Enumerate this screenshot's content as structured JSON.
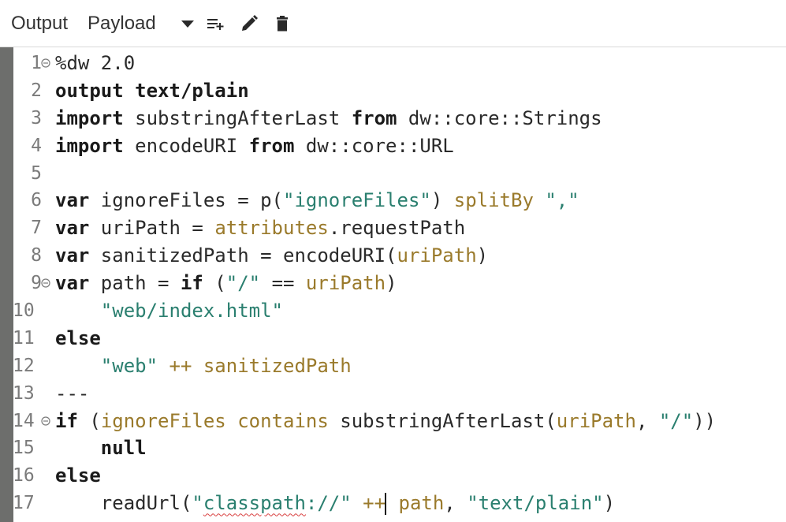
{
  "toolbar": {
    "output_label": "Output",
    "target_label": "Payload",
    "icons": [
      "chevron-down-icon",
      "add-icon",
      "edit-icon",
      "delete-icon"
    ]
  },
  "editor": {
    "lines": [
      {
        "num": "1",
        "fold": true,
        "tokens": [
          {
            "t": "%dw 2.0",
            "c": "plain"
          }
        ]
      },
      {
        "num": "2",
        "fold": false,
        "tokens": [
          {
            "t": "output",
            "c": "kw"
          },
          {
            "t": " ",
            "c": "plain"
          },
          {
            "t": "text/plain",
            "c": "kw"
          }
        ]
      },
      {
        "num": "3",
        "fold": false,
        "tokens": [
          {
            "t": "import",
            "c": "kw"
          },
          {
            "t": " substringAfterLast ",
            "c": "plain"
          },
          {
            "t": "from",
            "c": "kw"
          },
          {
            "t": " dw::core::Strings",
            "c": "plain"
          }
        ]
      },
      {
        "num": "4",
        "fold": false,
        "tokens": [
          {
            "t": "import",
            "c": "kw"
          },
          {
            "t": " encodeURI ",
            "c": "plain"
          },
          {
            "t": "from",
            "c": "kw"
          },
          {
            "t": " dw::core::URL",
            "c": "plain"
          }
        ]
      },
      {
        "num": "5",
        "fold": false,
        "tokens": []
      },
      {
        "num": "6",
        "fold": false,
        "tokens": [
          {
            "t": "var",
            "c": "kw"
          },
          {
            "t": " ignoreFiles = p(",
            "c": "plain"
          },
          {
            "t": "\"ignoreFiles\"",
            "c": "str"
          },
          {
            "t": ") ",
            "c": "plain"
          },
          {
            "t": "splitBy",
            "c": "attr"
          },
          {
            "t": " ",
            "c": "plain"
          },
          {
            "t": "\",\"",
            "c": "str"
          }
        ]
      },
      {
        "num": "7",
        "fold": false,
        "tokens": [
          {
            "t": "var",
            "c": "kw"
          },
          {
            "t": " uriPath = ",
            "c": "plain"
          },
          {
            "t": "attributes",
            "c": "attr"
          },
          {
            "t": ".requestPath",
            "c": "plain"
          }
        ]
      },
      {
        "num": "8",
        "fold": false,
        "tokens": [
          {
            "t": "var",
            "c": "kw"
          },
          {
            "t": " sanitizedPath = encodeURI(",
            "c": "plain"
          },
          {
            "t": "uriPath",
            "c": "attr"
          },
          {
            "t": ")",
            "c": "plain"
          }
        ]
      },
      {
        "num": "9",
        "fold": true,
        "tokens": [
          {
            "t": "var",
            "c": "kw"
          },
          {
            "t": " path = ",
            "c": "plain"
          },
          {
            "t": "if",
            "c": "kw"
          },
          {
            "t": " (",
            "c": "plain"
          },
          {
            "t": "\"/\"",
            "c": "str"
          },
          {
            "t": " == ",
            "c": "plain"
          },
          {
            "t": "uriPath",
            "c": "attr"
          },
          {
            "t": ")",
            "c": "plain"
          }
        ]
      },
      {
        "num": "10",
        "fold": false,
        "tokens": [
          {
            "t": "    ",
            "c": "plain"
          },
          {
            "t": "\"web/index.html\"",
            "c": "str"
          }
        ]
      },
      {
        "num": "11",
        "fold": false,
        "tokens": [
          {
            "t": "else",
            "c": "kw"
          }
        ]
      },
      {
        "num": "12",
        "fold": false,
        "tokens": [
          {
            "t": "    ",
            "c": "plain"
          },
          {
            "t": "\"web\"",
            "c": "str"
          },
          {
            "t": " ++ ",
            "c": "attr"
          },
          {
            "t": "sanitizedPath",
            "c": "attr"
          }
        ]
      },
      {
        "num": "13",
        "fold": false,
        "tokens": [
          {
            "t": "---",
            "c": "plain"
          }
        ]
      },
      {
        "num": "14",
        "fold": true,
        "tokens": [
          {
            "t": "if",
            "c": "kw"
          },
          {
            "t": " (",
            "c": "plain"
          },
          {
            "t": "ignoreFiles",
            "c": "attr"
          },
          {
            "t": " ",
            "c": "plain"
          },
          {
            "t": "contains",
            "c": "attr"
          },
          {
            "t": " substringAfterLast(",
            "c": "plain"
          },
          {
            "t": "uriPath",
            "c": "attr"
          },
          {
            "t": ", ",
            "c": "plain"
          },
          {
            "t": "\"/\"",
            "c": "str"
          },
          {
            "t": "))",
            "c": "plain"
          }
        ]
      },
      {
        "num": "15",
        "fold": false,
        "tokens": [
          {
            "t": "    ",
            "c": "plain"
          },
          {
            "t": "null",
            "c": "kw"
          }
        ]
      },
      {
        "num": "16",
        "fold": false,
        "tokens": [
          {
            "t": "else",
            "c": "kw"
          }
        ]
      },
      {
        "num": "17",
        "fold": false,
        "tokens": [
          {
            "t": "    readUrl(",
            "c": "plain"
          },
          {
            "t": "\"",
            "c": "str"
          },
          {
            "t": "classpath",
            "c": "str squiggle"
          },
          {
            "t": "://\"",
            "c": "str"
          },
          {
            "t": " ++",
            "c": "attr"
          },
          {
            "t": "CARET",
            "c": "caret"
          },
          {
            "t": " path",
            "c": "attr"
          },
          {
            "t": ", ",
            "c": "plain"
          },
          {
            "t": "\"text/plain\"",
            "c": "str"
          },
          {
            "t": ")",
            "c": "plain"
          }
        ]
      }
    ]
  }
}
